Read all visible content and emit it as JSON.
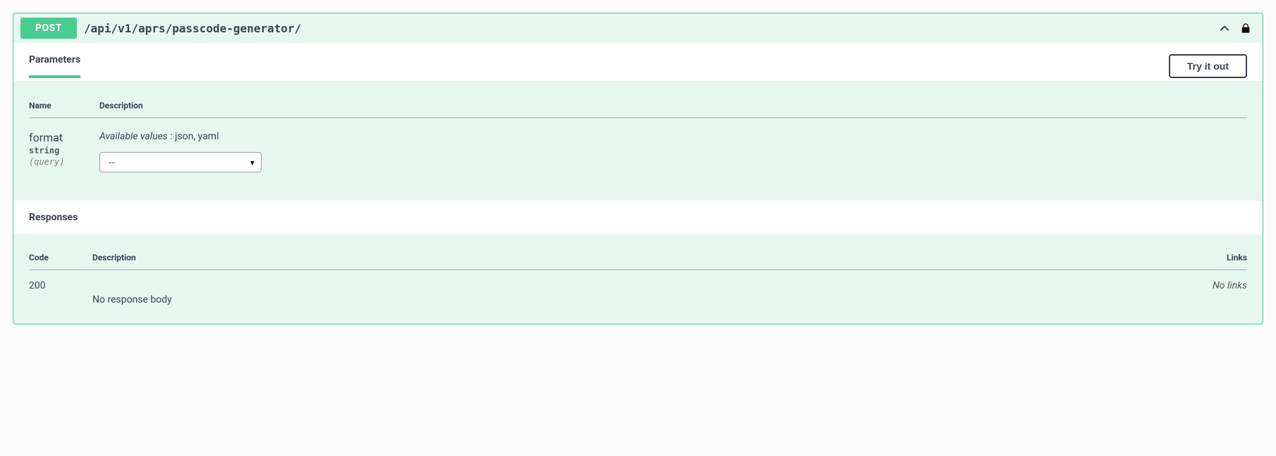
{
  "operation": {
    "method": "POST",
    "path": "/api/v1/aprs/passcode-generator/"
  },
  "tabs": {
    "parameters": "Parameters",
    "try_it_out": "Try it out"
  },
  "parameters": {
    "headers": {
      "name": "Name",
      "description": "Description"
    },
    "rows": [
      {
        "name": "format",
        "type": "string",
        "in": "(query)",
        "available_label": "Available values",
        "available_values": "json, yaml",
        "selected": "--",
        "options": [
          "--",
          "json",
          "yaml"
        ]
      }
    ]
  },
  "responses": {
    "title": "Responses",
    "headers": {
      "code": "Code",
      "description": "Description",
      "links": "Links"
    },
    "rows": [
      {
        "code": "200",
        "description": "No response body",
        "links": "No links"
      }
    ]
  }
}
